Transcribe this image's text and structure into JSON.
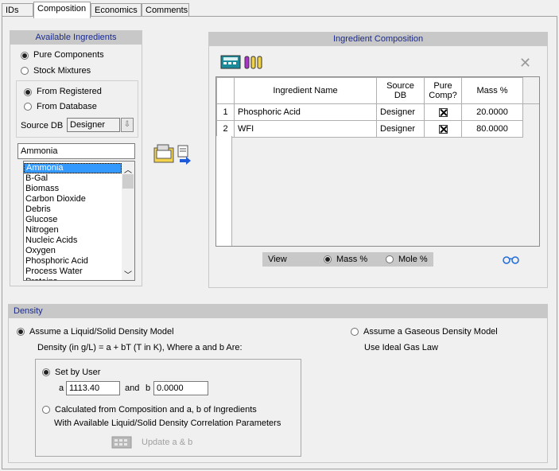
{
  "tabs": [
    "IDs",
    "Composition",
    "Economics",
    "Comments"
  ],
  "available": {
    "header": "Available Ingredients",
    "pure_components": "Pure Components",
    "stock_mixtures": "Stock Mixtures",
    "from_registered": "From Registered",
    "from_database": "From Database",
    "source_db_label": "Source DB",
    "source_db_value": "Designer",
    "search_value": "Ammonia",
    "list": [
      "Ammonia",
      "B-Gal",
      "Biomass",
      "Carbon Dioxide",
      "Debris",
      "Glucose",
      "Nitrogen",
      "Nucleic Acids",
      "Oxygen",
      "Phosphoric Acid",
      "Process Water",
      "Proteins"
    ]
  },
  "composition": {
    "header": "Ingredient Composition",
    "columns": [
      "Ingredient Name",
      "Source DB",
      "Pure Comp?",
      "Mass %"
    ],
    "rows": [
      {
        "num": "1",
        "name": "Phosphoric Acid",
        "db": "Designer",
        "mass": "20.0000"
      },
      {
        "num": "2",
        "name": "WFI",
        "db": "Designer",
        "mass": "80.0000"
      }
    ],
    "view_label": "View",
    "mass_pct": "Mass %",
    "mole_pct": "Mole %"
  },
  "density": {
    "header": "Density",
    "liquid_model": "Assume a Liquid/Solid Density Model",
    "formula": "Density (in g/L) = a + bT (T in K), Where a and b Are:",
    "gaseous_model": "Assume a Gaseous Density Model",
    "ideal_gas": "Use Ideal Gas Law",
    "set_by_user": "Set by User",
    "a_label": "a",
    "a_value": "1113.40",
    "and_label": "and",
    "b_label": "b",
    "b_value": "0.0000",
    "calculated_line1": "Calculated from Composition and a, b of Ingredients",
    "calculated_line2": "With Available Liquid/Solid Density Correlation Parameters",
    "update_button": "Update a & b"
  },
  "colors": {
    "header_text": "#1a2a8c",
    "selection": "#3399ff",
    "panel_header": "#c8c8c8"
  }
}
